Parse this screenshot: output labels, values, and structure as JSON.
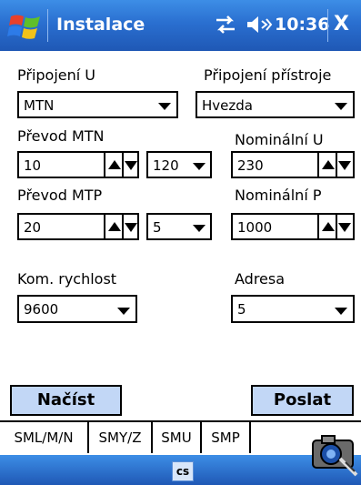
{
  "titlebar": {
    "title": "Instalace",
    "clock": "10:36",
    "close_label": "X",
    "accent": "#2a6fd0"
  },
  "form": {
    "pripojeni_u": {
      "label": "Připojení U",
      "value": "MTN"
    },
    "pripojeni_pristroje": {
      "label": "Připojení přístroje",
      "value": "Hvezda"
    },
    "prevod_mtn": {
      "label": "Převod MTN",
      "value": "10",
      "ratio_value": "120"
    },
    "nominalni_u": {
      "label": "Nominální U",
      "value": "230"
    },
    "prevod_mtp": {
      "label": "Převod MTP",
      "value": "20",
      "ratio_value": "5"
    },
    "nominalni_p": {
      "label": "Nominální P",
      "value": "1000"
    },
    "kom_rychlost": {
      "label": "Kom. rychlost",
      "value": "9600"
    },
    "adresa": {
      "label": "Adresa",
      "value": "5"
    }
  },
  "buttons": {
    "nacist": "Načíst",
    "poslat": "Poslat",
    "button_color": "#c2d7f6"
  },
  "tabs": [
    "SML/M/N",
    "SMY/Z",
    "SMU",
    "SMP"
  ],
  "active_tab": "SMY/Z",
  "taskbar": {
    "input_label": "cs"
  },
  "icons": [
    "windows-start-icon",
    "connectivity-icon",
    "speaker-icon",
    "close-icon",
    "dropdown-arrow-icon",
    "spin-up-icon",
    "spin-down-icon",
    "camera-icon"
  ]
}
